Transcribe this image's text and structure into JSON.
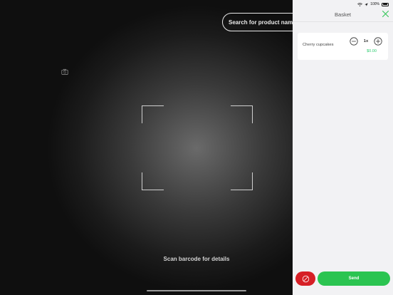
{
  "search": {
    "placeholder": "Search for product name"
  },
  "scanner": {
    "hint": "Scan barcode for details"
  },
  "status_bar": {
    "battery": "100%"
  },
  "basket": {
    "title": "Basket",
    "items": [
      {
        "name": "Cherry cupcakes",
        "quantity": "1x",
        "price": "$0.00"
      }
    ],
    "send_label": "Send"
  },
  "colors": {
    "accent_green": "#2bc451",
    "danger_red": "#d61f26",
    "price_green": "#2ecc71"
  },
  "icons": {
    "switch_camera": "camera-switch-icon",
    "close": "close-icon",
    "minus": "minus-circle-icon",
    "plus": "plus-circle-icon",
    "clear": "prohibited-icon",
    "wifi": "wifi-icon",
    "location": "location-arrow-icon",
    "battery": "battery-icon"
  }
}
